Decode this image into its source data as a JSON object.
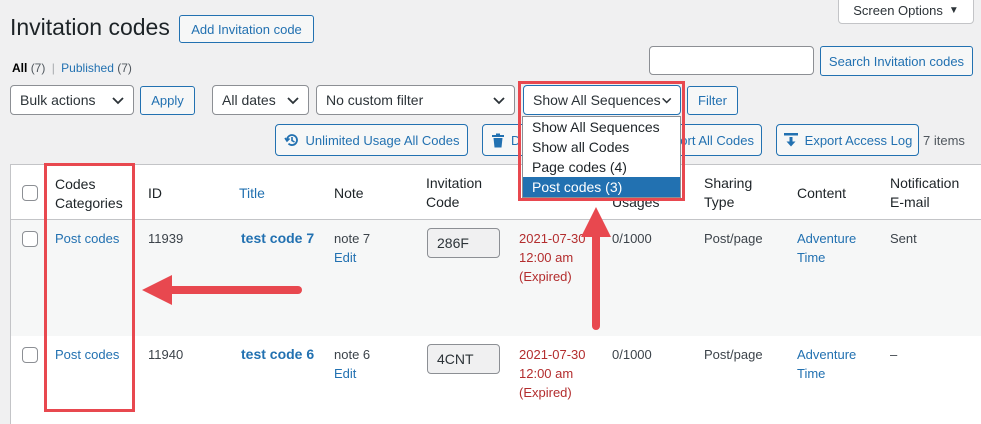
{
  "page": {
    "title": "Invitation codes",
    "add_button": "Add Invitation code",
    "screen_options": "Screen Options"
  },
  "filters": {
    "all_label": "All",
    "all_count": "(7)",
    "separator": "|",
    "published_label": "Published",
    "published_count": "(7)"
  },
  "search": {
    "value": "",
    "button": "Search Invitation codes"
  },
  "toolbar": {
    "bulk_actions": "Bulk actions",
    "apply": "Apply",
    "dates": "All dates",
    "custom_filter": "No custom filter",
    "sequences": "Show All Sequences",
    "filter": "Filter",
    "unlimited": "Unlimited Usage All Codes",
    "delete_partial": "D",
    "export_codes_partial": "ort All Codes",
    "export_log": "Export Access Log",
    "items_count": "7 items"
  },
  "sequence_dropdown": {
    "options": [
      "Show All Sequences",
      "Show all Codes",
      "Page codes  (4)",
      "Post codes  (3)"
    ],
    "highlighted_index": 3
  },
  "table": {
    "headers": {
      "categories_line1": "Codes",
      "categories_line2": "Categories",
      "id": "ID",
      "title": "Title",
      "note": "Note",
      "code_line1": "Invitation",
      "code_line2": "Code",
      "usages": "Usages",
      "sharing_line1": "Sharing",
      "sharing_line2": "Type",
      "content": "Content",
      "notif_line1": "Notification",
      "notif_line2": "E-mail"
    },
    "rows": [
      {
        "category": "Post codes",
        "id": "11939",
        "title": "test code 7",
        "note": "note 7",
        "note_edit": "Edit",
        "code": "286F",
        "date": "2021-07-30",
        "time": "12:00 am",
        "status": "(Expired)",
        "usages": "0/1000",
        "sharing": "Post/page",
        "content_line1": "Adventure",
        "content_line2": "Time",
        "notification": "Sent"
      },
      {
        "category": "Post codes",
        "id": "11940",
        "title": "test code 6",
        "note": "note 6",
        "note_edit": "Edit",
        "code": "4CNT",
        "date": "2021-07-30",
        "time": "12:00 am",
        "status": "(Expired)",
        "usages": "0/1000",
        "sharing": "Post/page",
        "content_line1": "Adventure",
        "content_line2": "Time",
        "notification": "–"
      }
    ]
  },
  "colors": {
    "accent": "#2271b1",
    "annotation_red": "#e8484f",
    "expired_red": "#b32d2e"
  }
}
